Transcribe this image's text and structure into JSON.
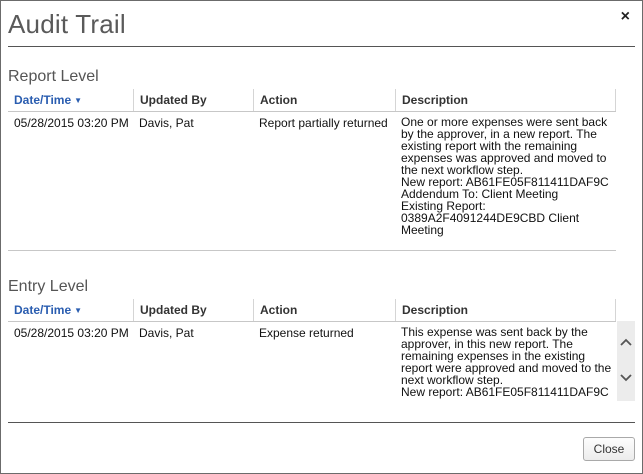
{
  "dialog": {
    "title": "Audit Trail",
    "close_glyph": "×",
    "close_button_label": "Close"
  },
  "report_level": {
    "section_title": "Report Level",
    "headers": {
      "date": "Date/Time",
      "updated_by": "Updated By",
      "action": "Action",
      "description": "Description"
    },
    "rows": [
      {
        "date": "05/28/2015 03:20 PM",
        "updated_by": "Davis, Pat",
        "action": "Report partially returned",
        "description": "One or more expenses were sent back\nby the approver, in a new report. The\nexisting report with the remaining\nexpenses was approved and moved to\nthe next workflow step.\nNew report: AB61FE05F811411DAF9C\nAddendum To: Client Meeting\nExisting Report:\n0389A2F4091244DE9CBD Client\nMeeting"
      }
    ]
  },
  "entry_level": {
    "section_title": "Entry Level",
    "headers": {
      "date": "Date/Time",
      "updated_by": "Updated By",
      "action": "Action",
      "description": "Description"
    },
    "rows": [
      {
        "date": "05/28/2015 03:20 PM",
        "updated_by": "Davis, Pat",
        "action": "Expense returned",
        "description": "This expense was sent back by the\napprover, in this new report. The\nremaining expenses in the existing\nreport were approved and moved to the\nnext workflow step.\nNew report: AB61FE05F811411DAF9C"
      }
    ]
  },
  "icons": {
    "sort": "sort-caret-down-icon",
    "close": "close-icon",
    "scroll_up": "chevron-up-icon",
    "scroll_down": "chevron-down-icon"
  }
}
